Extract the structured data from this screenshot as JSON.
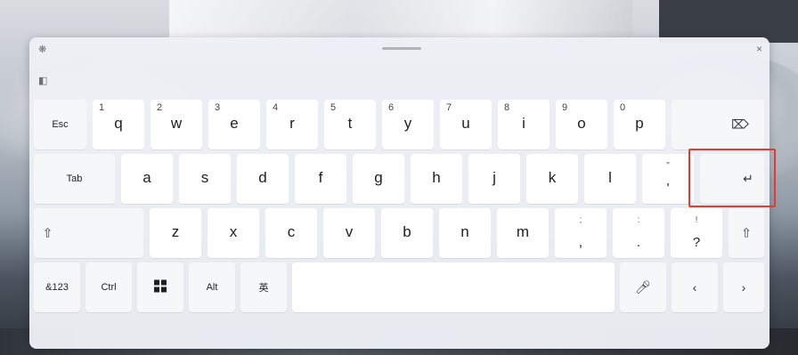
{
  "keyboard": {
    "row1": {
      "esc": "Esc",
      "keys": [
        {
          "sup": "1",
          "label": "q"
        },
        {
          "sup": "2",
          "label": "w"
        },
        {
          "sup": "3",
          "label": "e"
        },
        {
          "sup": "4",
          "label": "r"
        },
        {
          "sup": "5",
          "label": "t"
        },
        {
          "sup": "6",
          "label": "y"
        },
        {
          "sup": "7",
          "label": "u"
        },
        {
          "sup": "8",
          "label": "i"
        },
        {
          "sup": "9",
          "label": "o"
        },
        {
          "sup": "0",
          "label": "p"
        }
      ],
      "backspace_icon": "backspace-icon"
    },
    "row2": {
      "tab": "Tab",
      "keys": [
        "a",
        "s",
        "d",
        "f",
        "g",
        "h",
        "j",
        "k",
        "l"
      ],
      "colon_top": "\"",
      "colon_bottom": "'",
      "enter_icon": "enter-icon"
    },
    "row3": {
      "shift_icon": "shift-icon",
      "keys": [
        "z",
        "x",
        "c",
        "v",
        "b",
        "n",
        "m"
      ],
      "comma_top": ";",
      "comma_bottom": ",",
      "period_top": ":",
      "period_bottom": ".",
      "question_top": "!",
      "question_bottom": "?",
      "shift_right_icon": "shift-icon"
    },
    "row4": {
      "symbols": "&123",
      "ctrl": "Ctrl",
      "windows_icon": "windows-icon",
      "alt": "Alt",
      "language": "英",
      "mic_icon": "microphone-icon",
      "left_icon": "chevron-left-icon",
      "right_icon": "chevron-right-icon"
    }
  }
}
